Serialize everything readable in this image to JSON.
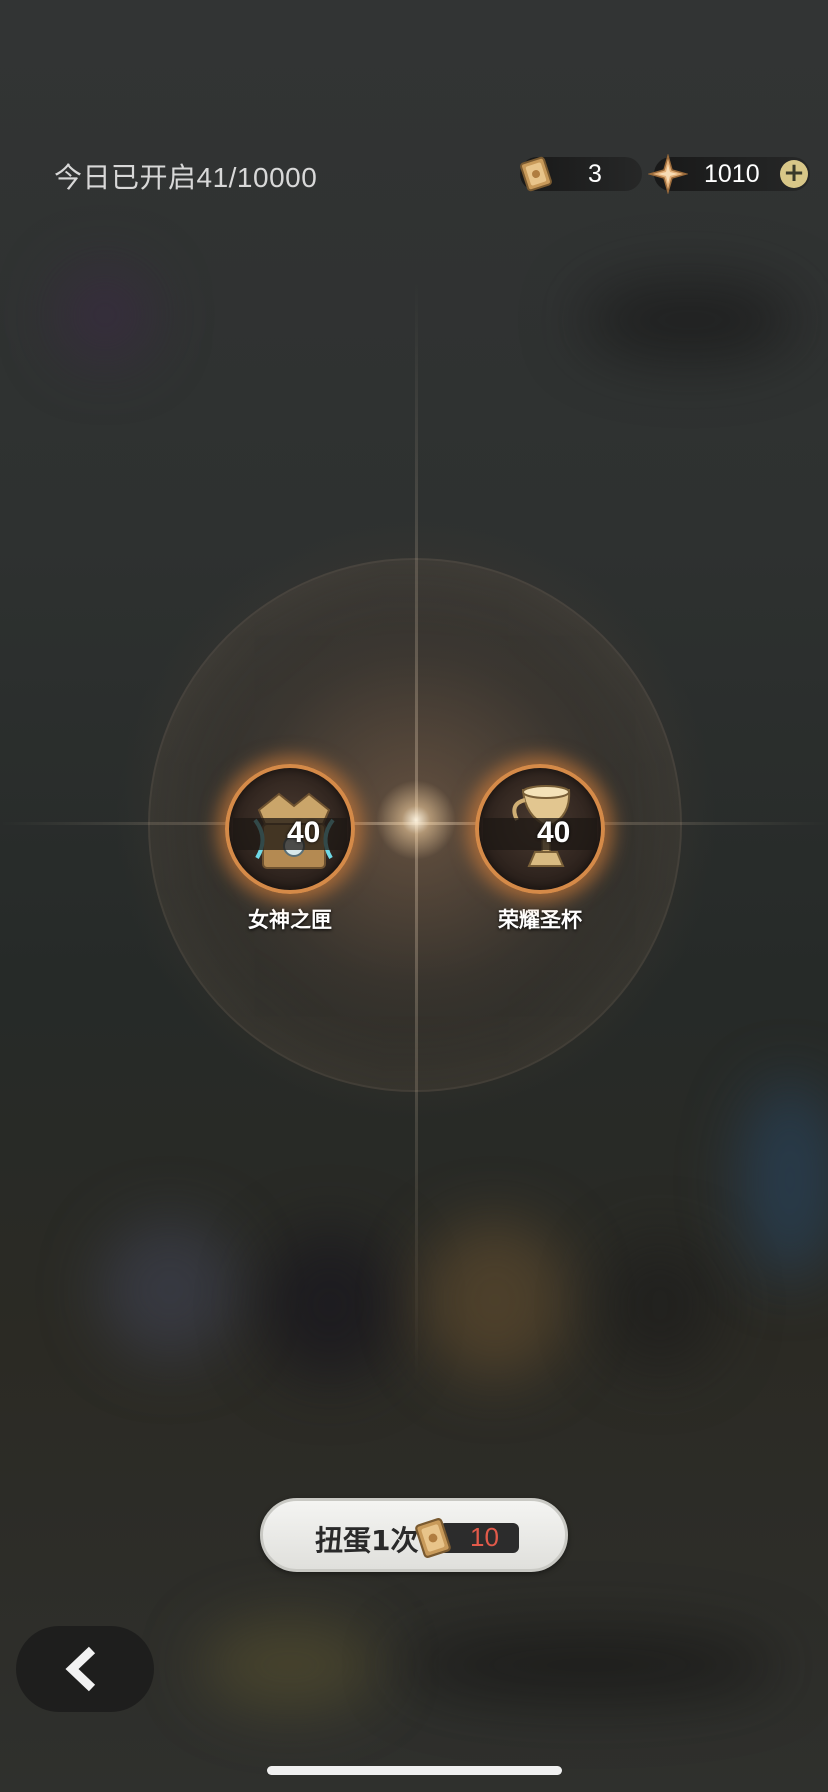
{
  "header": {
    "daily_opened_text": "今日已开启41/10000"
  },
  "resources": {
    "tickets": {
      "icon": "ticket-card-icon",
      "value": "3"
    },
    "crystals": {
      "icon": "star-crystal-icon",
      "value": "1010"
    },
    "add_icon": "plus-icon"
  },
  "rewards": [
    {
      "name": "女神之匣",
      "count": "40",
      "icon": "goddess-chest-icon"
    },
    {
      "name": "荣耀圣杯",
      "count": "40",
      "icon": "glory-chalice-icon"
    }
  ],
  "draw_button": {
    "label": "扭蛋1次",
    "cost": "10",
    "cost_icon": "ticket-card-icon",
    "cost_color": "#e25a4a"
  },
  "back_button": {
    "icon": "chevron-left-icon"
  },
  "colors": {
    "medal_ring": "#d58a48",
    "plus_button": "#d8c788"
  }
}
